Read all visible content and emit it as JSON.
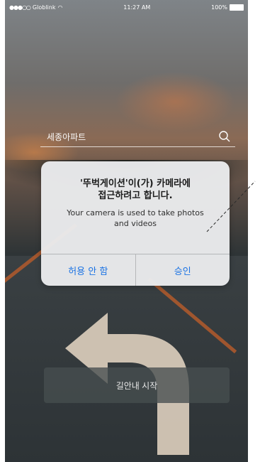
{
  "status_bar": {
    "carrier": "Globlink",
    "time": "11:27 AM",
    "battery": "100%"
  },
  "search": {
    "value": "세종아파트"
  },
  "alert": {
    "title_line1": "'뚜벅게이션'이(가) 카메라에",
    "title_line2": "접근하려고 합니다.",
    "message_line1": "Your camera is used to take photos",
    "message_line2": "and videos",
    "deny_label": "허용 안 함",
    "allow_label": "승인"
  },
  "start_button": {
    "label": "길안내 시작"
  },
  "colors": {
    "accent": "#1d74e4",
    "road_line": "#b35a2c"
  }
}
